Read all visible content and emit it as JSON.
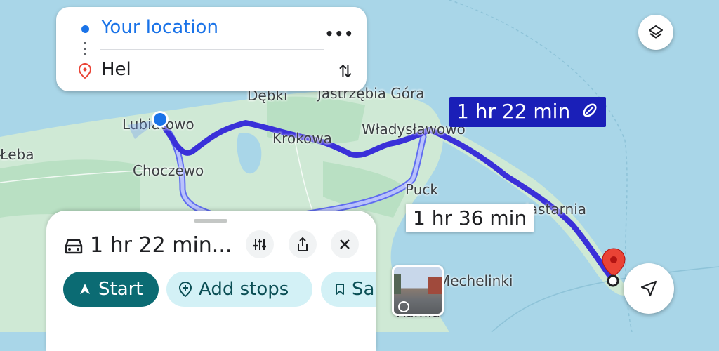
{
  "route": {
    "origin": "Your location",
    "destination": "Hel",
    "more_icon": "more-horizontal-icon",
    "swap_icon": "swap-vertical-icon"
  },
  "map": {
    "places": [
      {
        "name": "Dębki",
        "id": "debki"
      },
      {
        "name": "Jastrzębia Góra",
        "id": "jastrzebia-gora"
      },
      {
        "name": "Lubiatowo",
        "id": "lubiatowo"
      },
      {
        "name": "Krokowa",
        "id": "krokowa"
      },
      {
        "name": "Władysławowo",
        "id": "wladyslawowo"
      },
      {
        "name": "Łeba",
        "id": "leba"
      },
      {
        "name": "Choczewo",
        "id": "choczewo"
      },
      {
        "name": "Puck",
        "id": "puck"
      },
      {
        "name": "Jastarnia",
        "id": "jastarnia"
      },
      {
        "name": "Mechelinki",
        "id": "mechelinki"
      },
      {
        "name": "Rumia",
        "id": "rumia"
      }
    ],
    "primary_time": "1 hr 22 min",
    "alt_time": "1 hr 36 min",
    "colors": {
      "sea": "#a9d6e8",
      "land": "#cdebd2",
      "route": "#3a30d9",
      "alt_route": "#a7b3f5",
      "primary_tag": "#1a1fb8",
      "pin": "#ea4335"
    }
  },
  "sheet": {
    "eta": "1 hr 22 min...",
    "start_label": "Start",
    "add_stops_label": "Add stops",
    "save_label": "Sa"
  }
}
